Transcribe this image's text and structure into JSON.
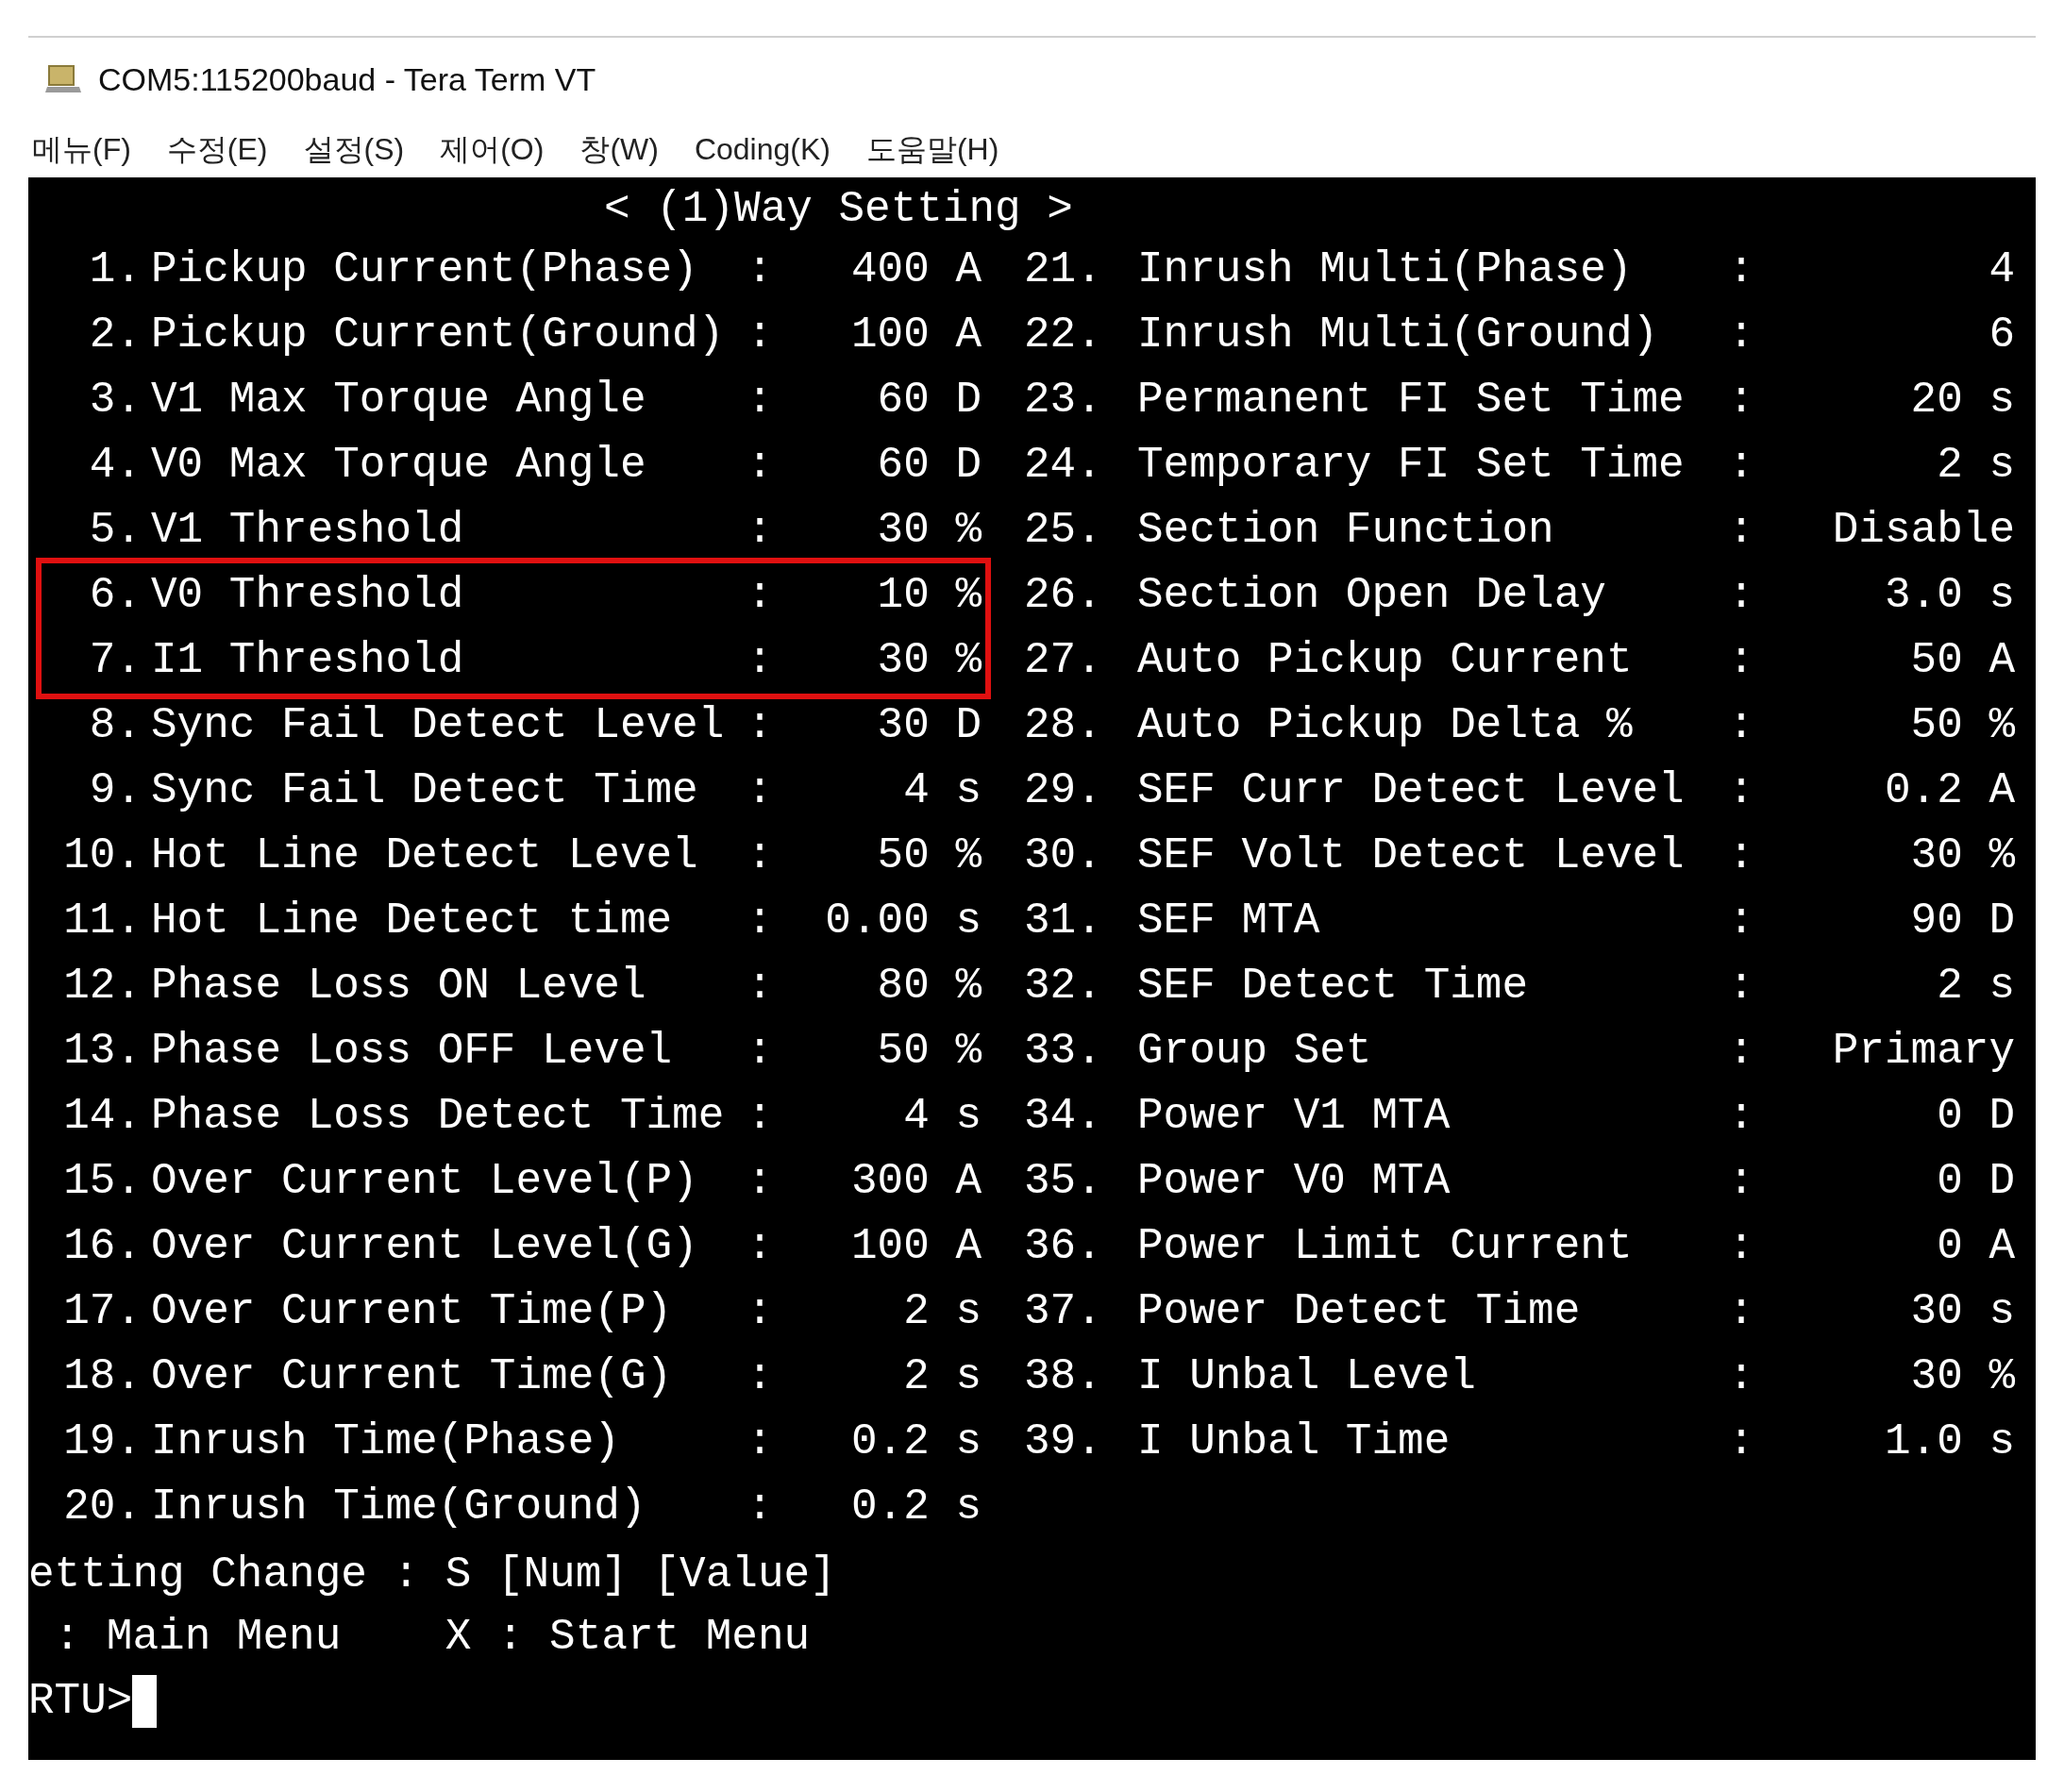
{
  "window": {
    "title": "COM5:115200baud - Tera Term VT"
  },
  "menu": [
    "메뉴(F)",
    "수정(E)",
    "설정(S)",
    "제어(O)",
    "창(W)",
    "Coding(K)",
    "도움말(H)"
  ],
  "terminal": {
    "header": "< (1)Way Setting >",
    "left": [
      {
        "num": "1.",
        "label": "Pickup Current(Phase)",
        "sep": ":",
        "value": "400 A",
        "highlighted": false
      },
      {
        "num": "2.",
        "label": "Pickup Current(Ground)",
        "sep": ":",
        "value": "100 A",
        "highlighted": false
      },
      {
        "num": "3.",
        "label": "V1 Max Torque Angle",
        "sep": ":",
        "value": "60 D",
        "highlighted": false
      },
      {
        "num": "4.",
        "label": "V0 Max Torque Angle",
        "sep": ":",
        "value": "60 D",
        "highlighted": false
      },
      {
        "num": "5.",
        "label": "V1 Threshold",
        "sep": ":",
        "value": "30 %",
        "highlighted": false
      },
      {
        "num": "6.",
        "label": "V0 Threshold",
        "sep": ":",
        "value": "10 %",
        "highlighted": true
      },
      {
        "num": "7.",
        "label": "I1 Threshold",
        "sep": ":",
        "value": "30 %",
        "highlighted": true
      },
      {
        "num": "8.",
        "label": "Sync Fail Detect Level",
        "sep": ":",
        "value": "30 D",
        "highlighted": false
      },
      {
        "num": "9.",
        "label": "Sync Fail Detect Time",
        "sep": ":",
        "value": "4 s",
        "highlighted": false
      },
      {
        "num": "10.",
        "label": "Hot Line Detect Level",
        "sep": ":",
        "value": "50 %",
        "highlighted": false
      },
      {
        "num": "11.",
        "label": "Hot Line Detect time",
        "sep": ":",
        "value": "0.00 s",
        "highlighted": false
      },
      {
        "num": "12.",
        "label": "Phase Loss ON Level",
        "sep": ":",
        "value": "80 %",
        "highlighted": false
      },
      {
        "num": "13.",
        "label": "Phase Loss OFF Level",
        "sep": ":",
        "value": "50 %",
        "highlighted": false
      },
      {
        "num": "14.",
        "label": "Phase Loss Detect Time",
        "sep": ":",
        "value": "4 s",
        "highlighted": false
      },
      {
        "num": "15.",
        "label": "Over Current Level(P)",
        "sep": ":",
        "value": "300 A",
        "highlighted": false
      },
      {
        "num": "16.",
        "label": "Over Current Level(G)",
        "sep": ":",
        "value": "100 A",
        "highlighted": false
      },
      {
        "num": "17.",
        "label": "Over Current Time(P)",
        "sep": ":",
        "value": "2 s",
        "highlighted": false
      },
      {
        "num": "18.",
        "label": "Over Current Time(G)",
        "sep": ":",
        "value": "2 s",
        "highlighted": false
      },
      {
        "num": "19.",
        "label": "Inrush Time(Phase)",
        "sep": ":",
        "value": "0.2 s",
        "highlighted": false
      },
      {
        "num": "20.",
        "label": "Inrush Time(Ground)",
        "sep": ":",
        "value": "0.2 s",
        "highlighted": false
      }
    ],
    "right": [
      {
        "num": "21.",
        "label": "Inrush Multi(Phase)",
        "sep": ":",
        "value": "4"
      },
      {
        "num": "22.",
        "label": "Inrush Multi(Ground)",
        "sep": ":",
        "value": "6"
      },
      {
        "num": "23.",
        "label": "Permanent FI Set Time",
        "sep": ":",
        "value": "20 s"
      },
      {
        "num": "24.",
        "label": "Temporary FI Set Time",
        "sep": ":",
        "value": "2 s"
      },
      {
        "num": "25.",
        "label": "Section Function",
        "sep": ":",
        "value": "Disable"
      },
      {
        "num": "26.",
        "label": "Section Open Delay",
        "sep": ":",
        "value": "3.0 s"
      },
      {
        "num": "27.",
        "label": "Auto Pickup Current",
        "sep": ":",
        "value": "50 A"
      },
      {
        "num": "28.",
        "label": "Auto Pickup Delta %",
        "sep": ":",
        "value": "50 %"
      },
      {
        "num": "29.",
        "label": "SEF Curr Detect Level",
        "sep": ":",
        "value": "0.2 A"
      },
      {
        "num": "30.",
        "label": "SEF Volt Detect Level",
        "sep": ":",
        "value": "30 %"
      },
      {
        "num": "31.",
        "label": "SEF MTA",
        "sep": ":",
        "value": "90 D"
      },
      {
        "num": "32.",
        "label": "SEF Detect Time",
        "sep": ":",
        "value": "2 s"
      },
      {
        "num": "33.",
        "label": "Group Set",
        "sep": ":",
        "value": "Primary"
      },
      {
        "num": "34.",
        "label": "Power V1 MTA",
        "sep": ":",
        "value": "0 D"
      },
      {
        "num": "35.",
        "label": "Power V0 MTA",
        "sep": ":",
        "value": "0 D"
      },
      {
        "num": "36.",
        "label": "Power Limit Current",
        "sep": ":",
        "value": "0 A"
      },
      {
        "num": "37.",
        "label": "Power Detect Time",
        "sep": ":",
        "value": "30 s"
      },
      {
        "num": "38.",
        "label": "I Unbal Level",
        "sep": ":",
        "value": "30 %"
      },
      {
        "num": "39.",
        "label": "I Unbal Time",
        "sep": ":",
        "value": "1.0 s"
      }
    ],
    "footer": [
      "etting Change : S [Num] [Value]",
      " : Main Menu    X : Start Menu"
    ],
    "prompt": "RTU>"
  }
}
